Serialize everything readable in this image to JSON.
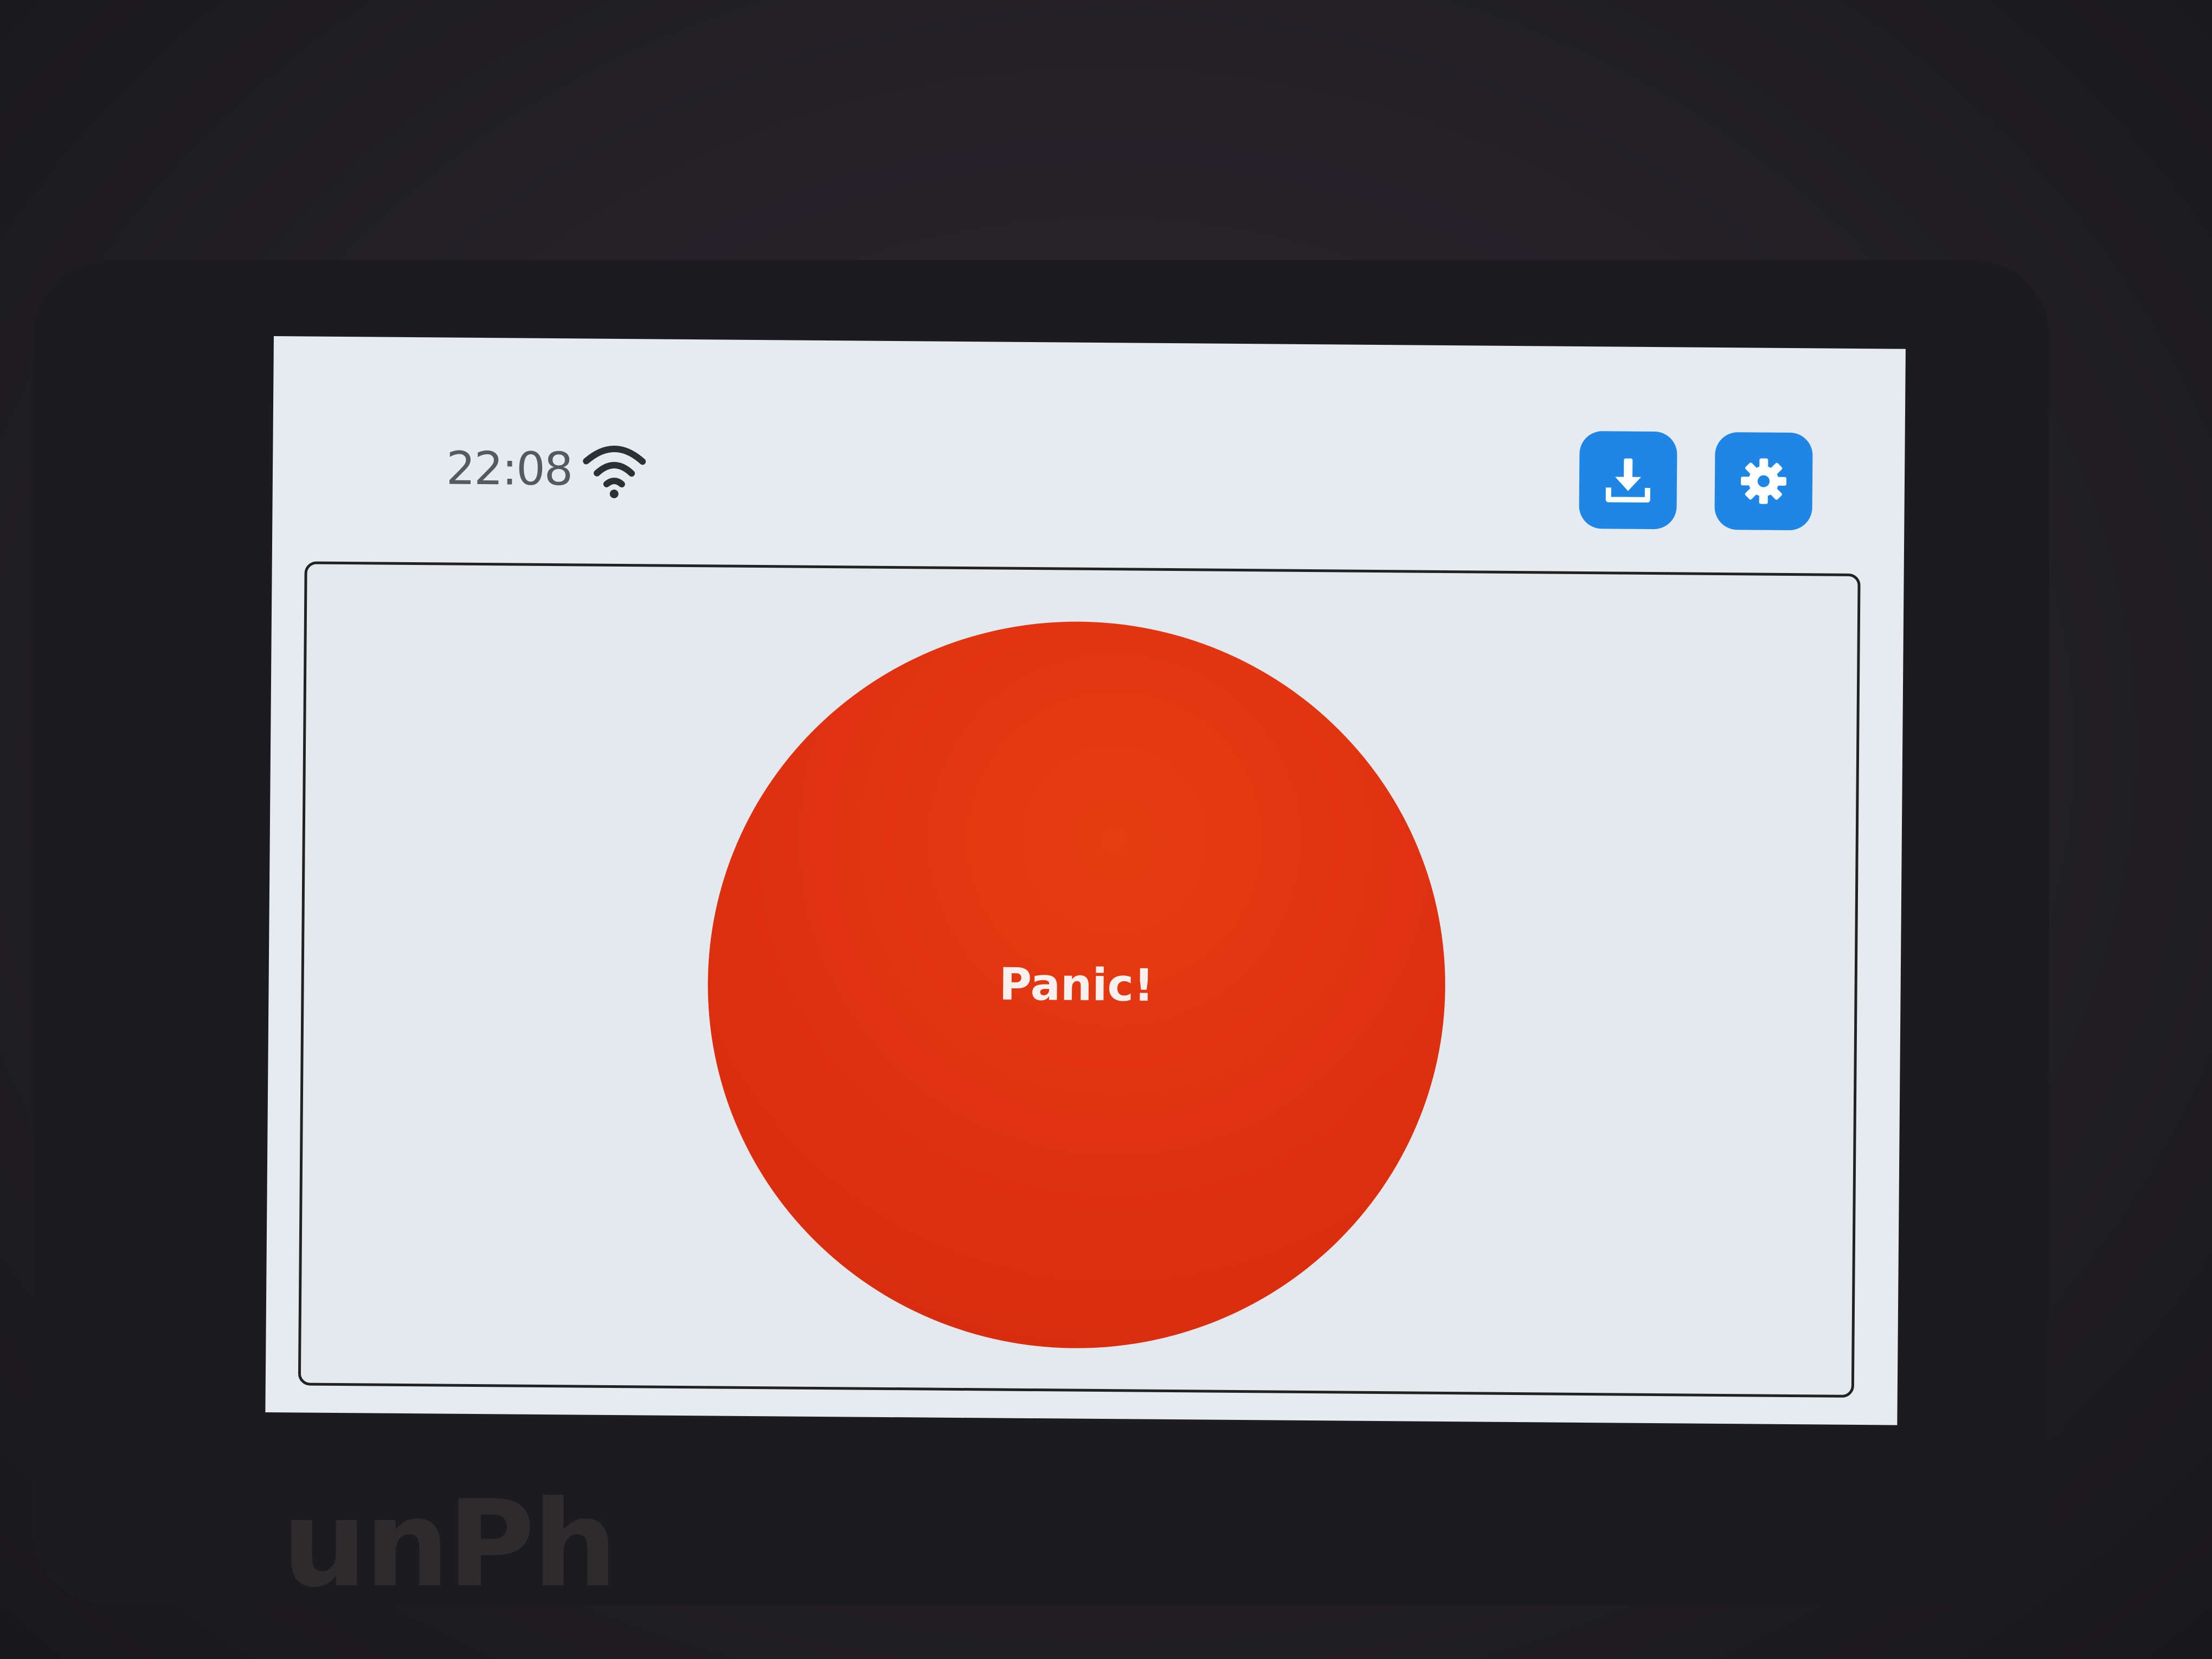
{
  "status_bar": {
    "time": "22:08",
    "wifi_icon": "wifi-icon"
  },
  "toolbar": {
    "install_icon": "download-icon",
    "settings_icon": "gear-icon",
    "accent_color": "#1f86e6"
  },
  "main": {
    "panic_label": "Panic!",
    "panic_color": "#e03210"
  },
  "device": {
    "brand": "unPh"
  }
}
